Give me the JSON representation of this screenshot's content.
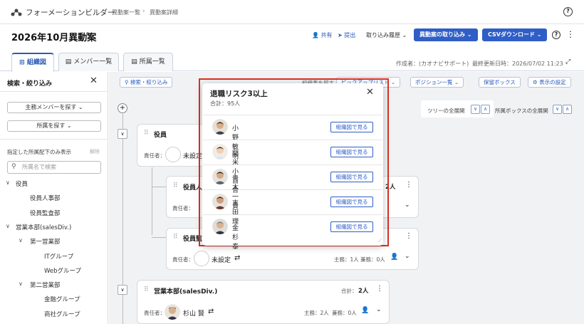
{
  "header": {
    "brand": "フォーメーションビルダー",
    "breadcrumb": [
      "異動案一覧",
      "異動案詳細"
    ],
    "help": "?"
  },
  "titlebar": {
    "title": "2026年10月異動案",
    "share": "共有",
    "submit": "提出",
    "import_history": "取り込み履歴",
    "import_button": "異動案の取り込み",
    "csv_button": "CSVダウンロード",
    "help": "?"
  },
  "tabs": [
    {
      "label": "組織図",
      "active": true
    },
    {
      "label": "メンバー一覧",
      "active": false
    },
    {
      "label": "所属一覧",
      "active": false
    }
  ],
  "meta": {
    "author": "作成者：(カオナビサポート)",
    "updated": "最終更新日時：2026/07/02 11:23"
  },
  "sidebar": {
    "title": "検索・絞り込み",
    "find_main": "主務メンバーを探す",
    "find_dept": "所属を探す",
    "only_under": "指定した所属配下のみ表示",
    "clear": "解除",
    "search_placeholder": "所属名で検索",
    "tree": [
      {
        "label": "役員",
        "level": 0,
        "toggle": "∨"
      },
      {
        "label": "役員人事部",
        "level": 1,
        "toggle": ""
      },
      {
        "label": "役員監査部",
        "level": 1,
        "toggle": ""
      },
      {
        "label": "営業本部(salesDiv.)",
        "level": 0,
        "toggle": "∨"
      },
      {
        "label": "第一営業部",
        "level": 1,
        "toggle": "∨"
      },
      {
        "label": "ITグループ",
        "level": 2,
        "toggle": ""
      },
      {
        "label": "Webグループ",
        "level": 2,
        "toggle": ""
      },
      {
        "label": "第二営業部",
        "level": 1,
        "toggle": "∨"
      },
      {
        "label": "金融グループ",
        "level": 2,
        "toggle": ""
      },
      {
        "label": "商社グループ",
        "level": 2,
        "toggle": ""
      }
    ]
  },
  "toolbar": {
    "search_filter": "検索・絞り込み",
    "display_label": "組織表を探す",
    "picked": "ピックアップリスト",
    "position_list": "ポジション一覧",
    "hold_box": "保留ボックス",
    "display_settings": "表示の設定",
    "tree_expand_all": "ツリーの全展開",
    "box_expand_all": "所属ボックスの全展開"
  },
  "cards": {
    "exec": {
      "title": "役員",
      "owner_label": "責任者：",
      "owner": "未設定"
    },
    "exec_hr": {
      "title": "役員人",
      "total": "2人",
      "owner_label": "責任者："
    },
    "exec_audit": {
      "title": "役員監",
      "owner_label": "責任者：",
      "owner": "未設定",
      "main": "主務：1人",
      "concurrent": "兼務：0人"
    },
    "sales": {
      "title": "営業本部(salesDiv.)",
      "total_label": "合計：",
      "total": "2人",
      "owner_label": "責任者：",
      "owner": "杉山 賢",
      "main": "主務：2人",
      "concurrent": "兼務：0人"
    }
  },
  "popup": {
    "title": "退職リスク3以上",
    "total": "合計：95人",
    "button_label": "組織図で見る",
    "people": [
      {
        "name": "小野 敏明",
        "icon": "person-male-avatar"
      },
      {
        "name": "開米 小百合",
        "icon": "person-female-avatar"
      },
      {
        "name": "青木 一貴",
        "icon": "person-male-avatar"
      },
      {
        "name": "吉田 理",
        "icon": "person-male-avatar"
      },
      {
        "name": "金杉 泰",
        "icon": "person-male-avatar"
      }
    ]
  },
  "colors": {
    "accent": "#2f5ec6",
    "highlight": "#d93025",
    "canvas": "#f1f2f4"
  }
}
